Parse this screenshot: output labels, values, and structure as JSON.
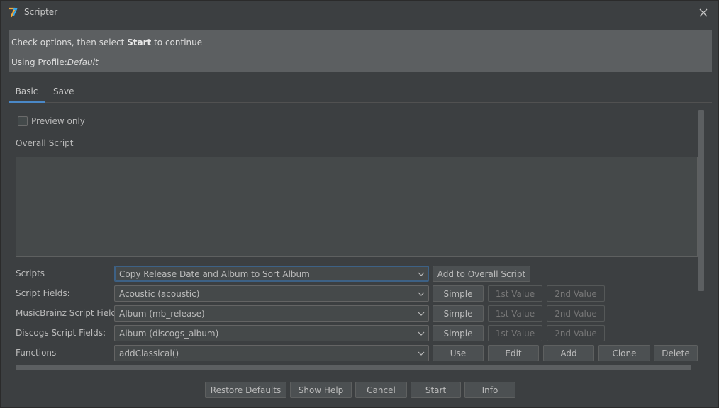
{
  "window": {
    "title": "Scripter"
  },
  "banner": {
    "line1_prefix": "Check options, then select ",
    "line1_bold": "Start",
    "line1_suffix": " to continue",
    "profile_label": "Using Profile:",
    "profile_name": "Default"
  },
  "tabs": [
    {
      "label": "Basic",
      "active": true
    },
    {
      "label": "Save",
      "active": false
    }
  ],
  "preview": {
    "label": "Preview only",
    "checked": false
  },
  "overall_script": {
    "label": "Overall Script",
    "value": ""
  },
  "rows": {
    "scripts": {
      "label": "Scripts",
      "value": "Copy Release Date and Album to Sort Album",
      "buttons": [
        "Add to Overall Script"
      ]
    },
    "script_fields": {
      "label": "Script Fields:",
      "value": "Acoustic (acoustic)",
      "buttons": [
        "Simple",
        "1st Value",
        "2nd Value"
      ]
    },
    "mb_fields": {
      "label": "MusicBrainz Script Fields:",
      "value": "Album (mb_release)",
      "buttons": [
        "Simple",
        "1st Value",
        "2nd Value"
      ]
    },
    "discogs_fields": {
      "label": "Discogs Script Fields:",
      "value": "Album (discogs_album)",
      "buttons": [
        "Simple",
        "1st Value",
        "2nd Value"
      ]
    },
    "functions": {
      "label": "Functions",
      "value": "addClassical()",
      "buttons": [
        "Use",
        "Edit",
        "Add",
        "Clone",
        "Delete"
      ]
    }
  },
  "footer": {
    "restore": "Restore Defaults",
    "help": "Show Help",
    "cancel": "Cancel",
    "start": "Start",
    "info": "Info"
  },
  "colors": {
    "background": "#3c3f41",
    "banner": "#5c5f61",
    "accent": "#4a88c7",
    "text": "#bbbbbb"
  },
  "icons": {
    "app": "jaikoz-app-icon",
    "close": "close-icon",
    "dropdown": "chevron-down-icon"
  }
}
